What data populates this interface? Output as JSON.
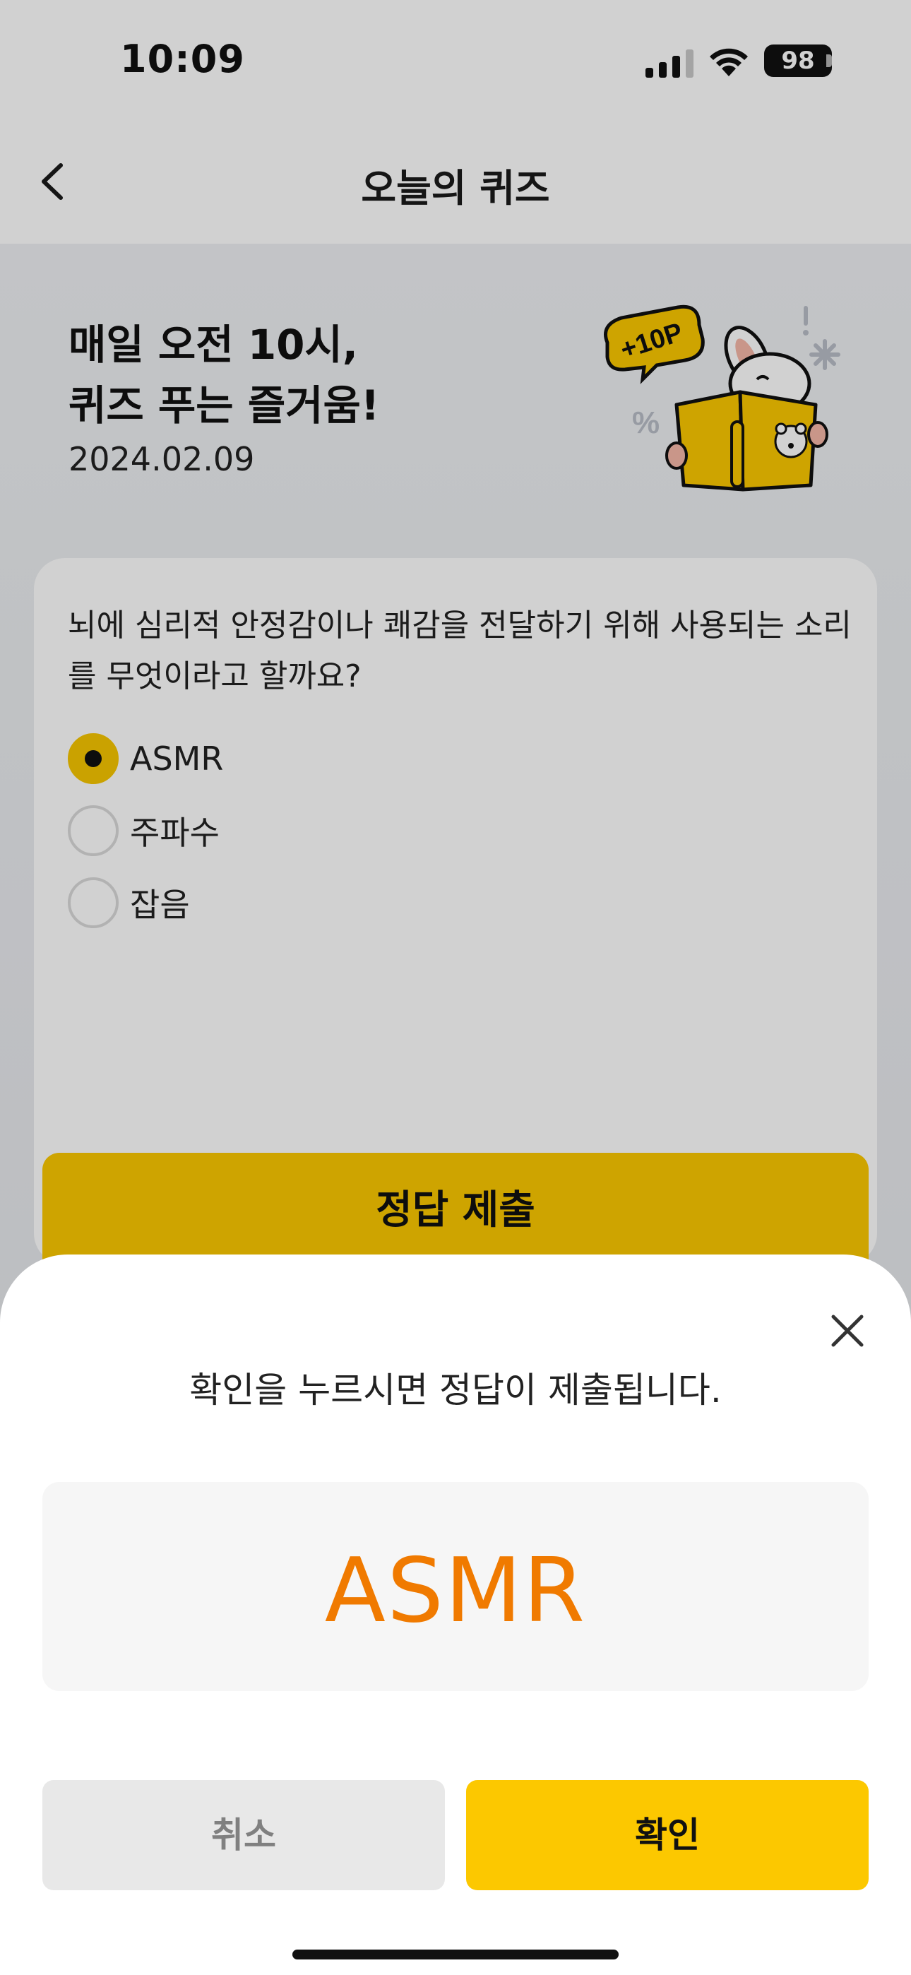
{
  "status_bar": {
    "time": "10:09",
    "battery": "98",
    "icons": [
      "signal-icon",
      "wifi-icon",
      "battery-icon"
    ]
  },
  "nav": {
    "title": "오늘의 퀴즈",
    "back_icon": "chevron-left-icon"
  },
  "hero": {
    "title_line1": "매일 오전 10시,",
    "title_line2": "퀴즈 푸는 즐거움!",
    "date": "2024.02.09",
    "badge": "+10P"
  },
  "quiz": {
    "question": "뇌에 심리적 안정감이나 쾌감을 전달하기 위해 사용되는 소리를 무엇이라고 할까요?",
    "options": [
      {
        "label": "ASMR",
        "selected": true
      },
      {
        "label": "주파수",
        "selected": false
      },
      {
        "label": "잡음",
        "selected": false
      }
    ],
    "submit_label": "정답 제출"
  },
  "sheet": {
    "message": "확인을 누르시면 정답이 제출됩니다.",
    "answer": "ASMR",
    "cancel_label": "취소",
    "confirm_label": "확인",
    "close_icon": "close-icon"
  },
  "colors": {
    "accent_yellow": "#fcc800",
    "answer_orange": "#f07a00",
    "cancel_gray": "#e8e8e8"
  }
}
